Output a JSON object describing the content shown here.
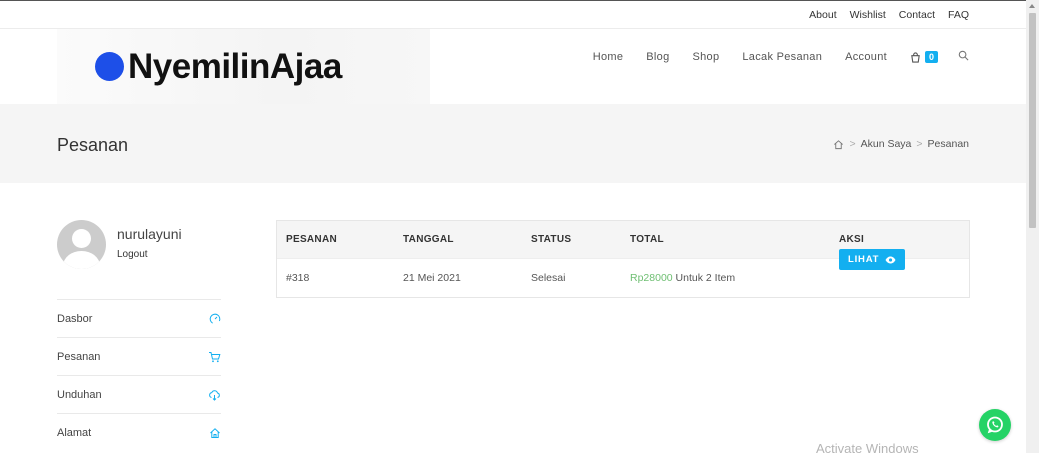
{
  "topbar": {
    "links": [
      "About",
      "Wishlist",
      "Contact",
      "FAQ"
    ]
  },
  "header": {
    "logo_text": "NyemilinAjaa",
    "nav": [
      "Home",
      "Blog",
      "Shop",
      "Lacak Pesanan",
      "Account"
    ],
    "cart_count": "0"
  },
  "page": {
    "title": "Pesanan",
    "breadcrumb": [
      "Akun Saya",
      "Pesanan"
    ]
  },
  "user": {
    "name": "nurulayuni",
    "logout_label": "Logout"
  },
  "side_menu": [
    {
      "label": "Dasbor",
      "icon": "gauge-icon"
    },
    {
      "label": "Pesanan",
      "icon": "cart-icon"
    },
    {
      "label": "Unduhan",
      "icon": "cloud-download-icon"
    },
    {
      "label": "Alamat",
      "icon": "home-icon"
    }
  ],
  "orders": {
    "columns": [
      "PESANAN",
      "TANGGAL",
      "STATUS",
      "TOTAL",
      "AKSI"
    ],
    "rows": [
      {
        "order": "#318",
        "date": "21 Mei 2021",
        "status": "Selesai",
        "amount": "Rp28000",
        "items": " Untuk 2 Item",
        "action": "LIHAT"
      }
    ]
  },
  "watermark": "Activate Windows",
  "colors": {
    "accent": "#13aff0",
    "price": "#6fbf73",
    "logo_dot": "#1d4fe8",
    "whatsapp": "#25d366"
  }
}
